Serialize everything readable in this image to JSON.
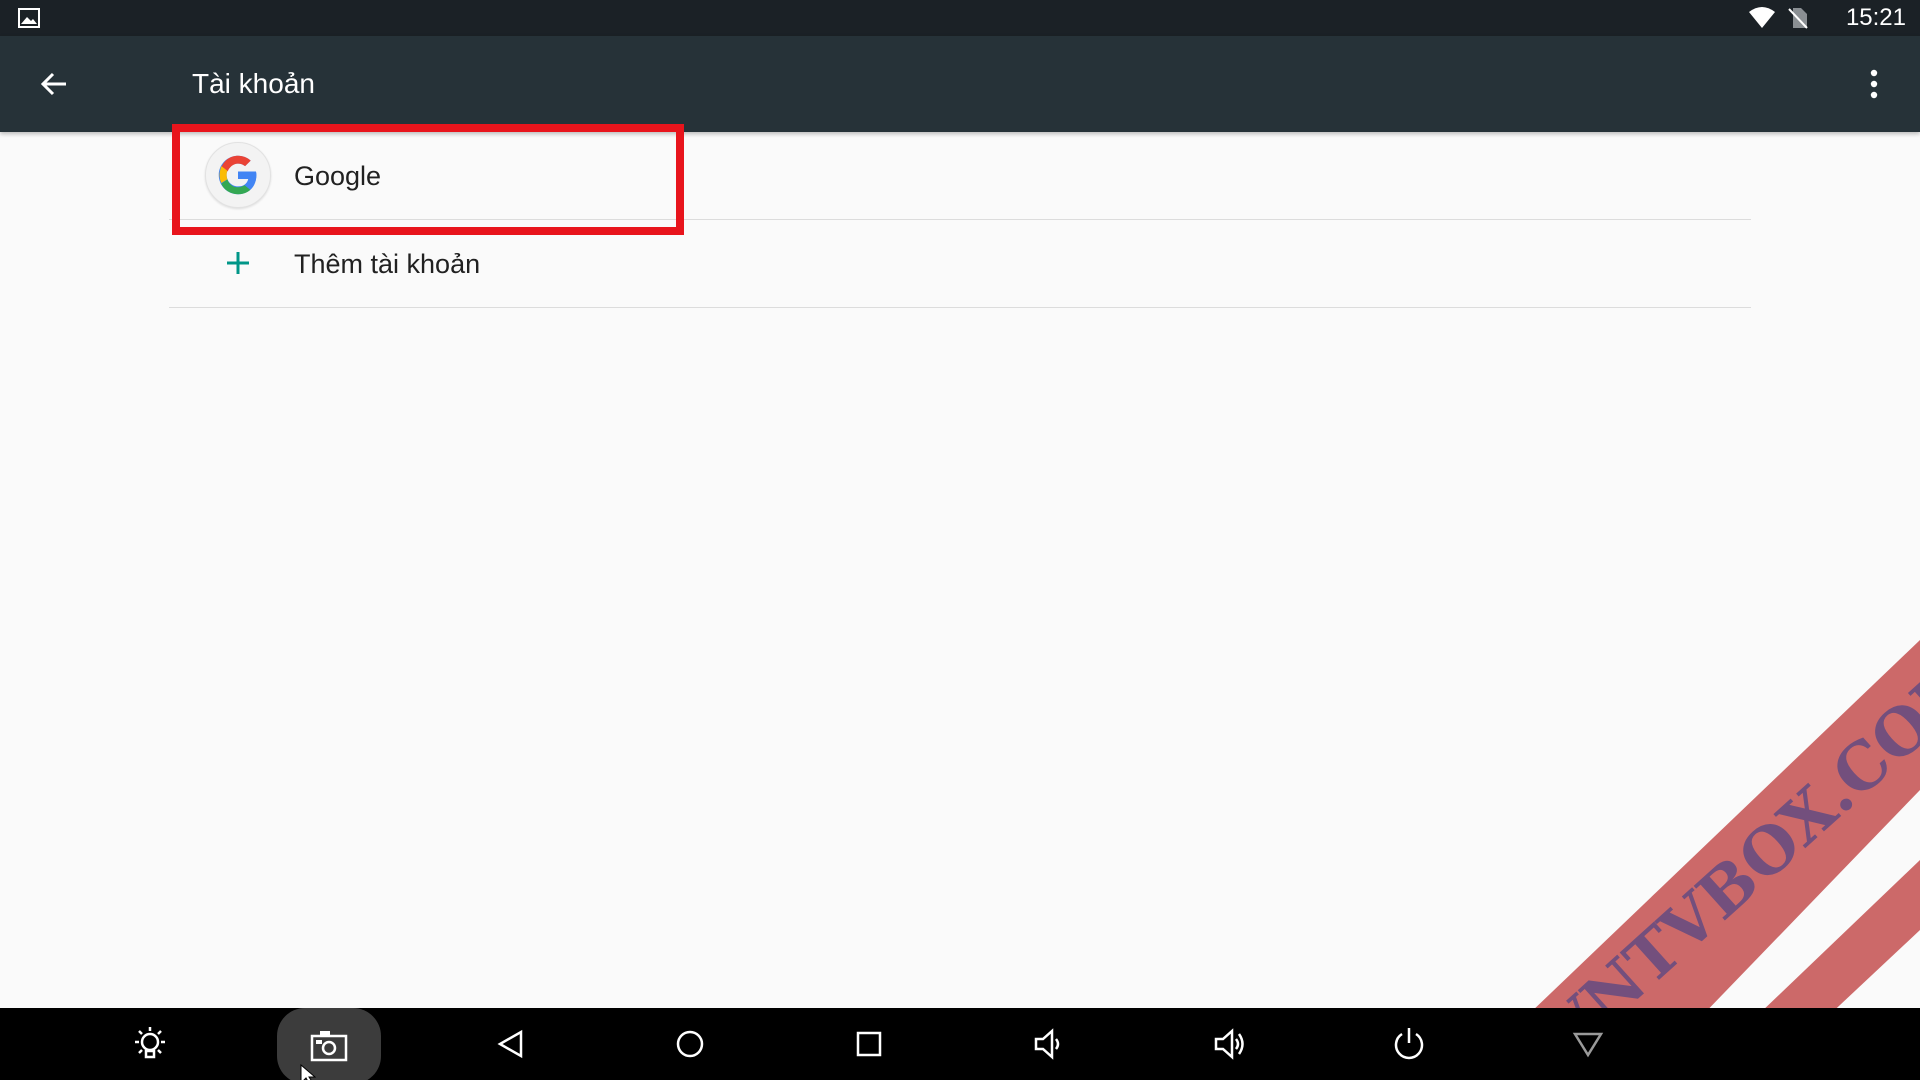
{
  "status_bar": {
    "time": "15:21",
    "icons": [
      "image-notification-icon",
      "wifi-icon",
      "no-sim-icon"
    ]
  },
  "app_bar": {
    "title": "Tài khoản",
    "back_icon": "arrow-back-icon",
    "overflow_icon": "more-vert-icon"
  },
  "accounts": {
    "items": [
      {
        "label": "Google",
        "icon": "google-logo-icon"
      },
      {
        "label": "Thêm tài khoản",
        "icon": "plus-icon"
      }
    ]
  },
  "nav_bar": {
    "buttons": [
      "brightness-icon",
      "screenshot-icon",
      "back-triangle-icon",
      "home-circle-icon",
      "recents-square-icon",
      "volume-down-icon",
      "volume-up-icon",
      "power-icon",
      "collapse-triangle-icon"
    ],
    "active_button": "screenshot-icon"
  },
  "watermark": {
    "text": "VNTVBOX.COM"
  },
  "colors": {
    "status_bar": "#1b2126",
    "app_bar": "#263238",
    "background": "#fafafa",
    "accent_plus": "#009688",
    "highlight": "#e8141c",
    "nav_bar": "#000000",
    "watermark": "#b41c1c"
  }
}
